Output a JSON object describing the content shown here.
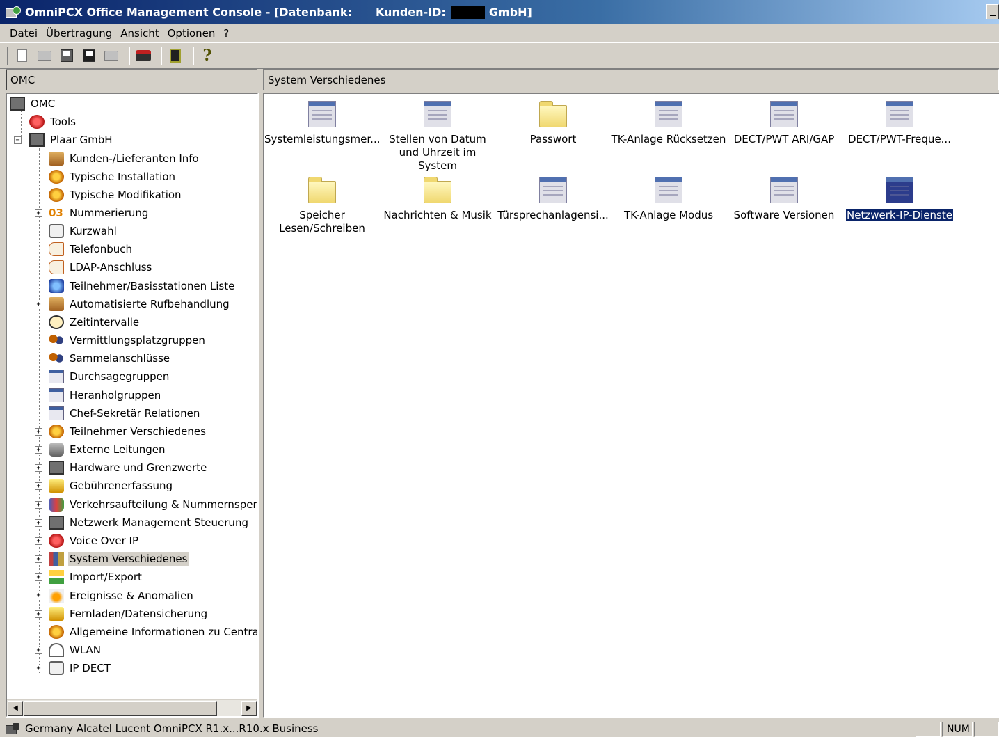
{
  "window": {
    "title": "OmniPCX Office Management Console - [Datenbank:",
    "customer_id_label": "Kunden-ID:",
    "title_end": "GmbH]"
  },
  "menu": [
    "Datei",
    "Übertragung",
    "Ansicht",
    "Optionen",
    "?"
  ],
  "toolbar": {
    "buttons": [
      "new-icon",
      "open-icon",
      "save-icon",
      "save-as-icon",
      "upload-icon",
      "print-icon",
      "exit-icon",
      "help-icon"
    ]
  },
  "left_header": "OMC",
  "right_header": "System Verschiedenes",
  "tree": {
    "root": "OMC",
    "tools": "Tools",
    "site": "Plaar GmbH",
    "items": [
      "Kunden-/Lieferanten Info",
      "Typische Installation",
      "Typische Modifikation",
      "Nummerierung",
      "Kurzwahl",
      "Telefonbuch",
      "LDAP-Anschluss",
      "Teilnehmer/Basisstationen Liste",
      "Automatisierte Rufbehandlung",
      "Zeitintervalle",
      "Vermittlungsplatzgruppen",
      "Sammelanschlüsse",
      "Durchsagegruppen",
      "Heranholgruppen",
      "Chef-Sekretär Relationen",
      "Teilnehmer Verschiedenes",
      "Externe Leitungen",
      "Hardware und Grenzwerte",
      "Gebührenerfassung",
      "Verkehrsaufteilung & Nummernsperre",
      "Netzwerk Management Steuerung",
      "Voice Over IP",
      "System Verschiedenes",
      "Import/Export",
      "Ereignisse & Anomalien",
      "Fernladen/Datensicherung",
      "Allgemeine Informationen zu Central Se",
      "WLAN",
      "IP DECT"
    ],
    "selected": "System Verschiedenes"
  },
  "content_items": [
    {
      "label": "Systemleistungsmer...",
      "icon": "form-icon"
    },
    {
      "label": "Stellen von Datum und Uhrzeit im System",
      "icon": "form-icon"
    },
    {
      "label": "Passwort",
      "icon": "folder-icon"
    },
    {
      "label": "TK-Anlage Rücksetzen",
      "icon": "form-icon"
    },
    {
      "label": "DECT/PWT ARI/GAP",
      "icon": "form-icon"
    },
    {
      "label": "DECT/PWT-Freque...",
      "icon": "form-icon"
    },
    {
      "label": "Speicher Lesen/Schreiben",
      "icon": "folder-icon"
    },
    {
      "label": "Nachrichten & Musik",
      "icon": "folder-icon"
    },
    {
      "label": "Türsprechanlagensi...",
      "icon": "form-icon"
    },
    {
      "label": "TK-Anlage Modus",
      "icon": "form-icon"
    },
    {
      "label": "Software Versionen",
      "icon": "form-icon"
    },
    {
      "label": "Netzwerk-IP-Dienste",
      "icon": "form-icon",
      "selected": true
    }
  ],
  "status": {
    "text": "Germany Alcatel Lucent OmniPCX R1.x...R10.x Business",
    "num": "NUM"
  }
}
